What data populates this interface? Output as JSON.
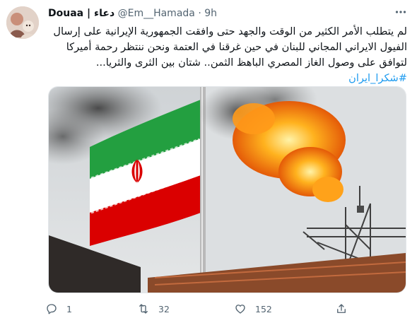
{
  "user": {
    "display_name": "Douaa | دعاء",
    "handle": "@Em__Hamada",
    "separator": "·",
    "time": "9h"
  },
  "tweet": {
    "lines": [
      "لم يتطلب الأمر الكثير من الوقت والجهد حتى وافقت الجمهورية الإيرانية على إرسال",
      "الفيول الايراني المجاني للبنان في حين غرقنا في العتمة ونحن ننتظر رحمة أميركا",
      "لتوافق على وصول الغاز المصري الباهظ الثمن.. شتان بين الثرى والثريا..."
    ],
    "hashtag": "#شكرا_ايران"
  },
  "actions": {
    "reply_count": "1",
    "retweet_count": "32",
    "like_count": "152",
    "share_count": ""
  },
  "icons": {
    "more": "more-icon",
    "reply": "reply-icon",
    "retweet": "retweet-icon",
    "like": "like-icon",
    "share": "share-icon"
  },
  "colors": {
    "link": "#1d9bf0",
    "muted": "#536471",
    "text": "#0f1419",
    "flag_green": "#239f40",
    "flag_red": "#da0000"
  }
}
